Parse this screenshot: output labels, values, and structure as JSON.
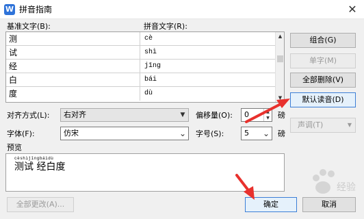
{
  "window": {
    "title": "拼音指南",
    "app_icon_letter": "W",
    "close_glyph": "✕"
  },
  "labels": {
    "base_text_header": "基准文字(B):",
    "pinyin_text_header": "拼音文字(R):",
    "alignment": "对齐方式(L):",
    "offset": "偏移量(O):",
    "font": "字体(F):",
    "size": "字号(S):",
    "pound": "磅",
    "preview": "预览"
  },
  "rows": [
    {
      "base": "测",
      "pinyin": "cè"
    },
    {
      "base": "试",
      "pinyin": "shì"
    },
    {
      "base": "经",
      "pinyin": "jīng"
    },
    {
      "base": "白",
      "pinyin": "bái"
    },
    {
      "base": "度",
      "pinyin": "dù"
    }
  ],
  "controls": {
    "alignment_value": "右对齐",
    "offset_value": "0",
    "font_value": "仿宋",
    "size_value": "5"
  },
  "buttons": {
    "combine": "组合(G)",
    "single_char": "单字(M)",
    "delete_all": "全部删除(V)",
    "default_reading": "默认读音(D)",
    "tone": "声调(T)",
    "change_all": "全部更改(A)...",
    "ok": "确定",
    "cancel": "取消"
  },
  "preview": {
    "pinyin_line": "cèshìjīngbáidù",
    "text_line": "测试 经白度"
  },
  "watermark": {
    "text": "经验"
  },
  "colors": {
    "annotation_arrow": "#e8312d",
    "focus_border": "#3b7ed6",
    "app_icon": "#2f73d9"
  },
  "icons": {
    "scroll_up": "▲",
    "scroll_down": "▼",
    "dropdown": "▼",
    "tone_dropdown": "▼",
    "dropdown_chevron": "⌄",
    "spin_up": "▲",
    "spin_down": "▼"
  }
}
